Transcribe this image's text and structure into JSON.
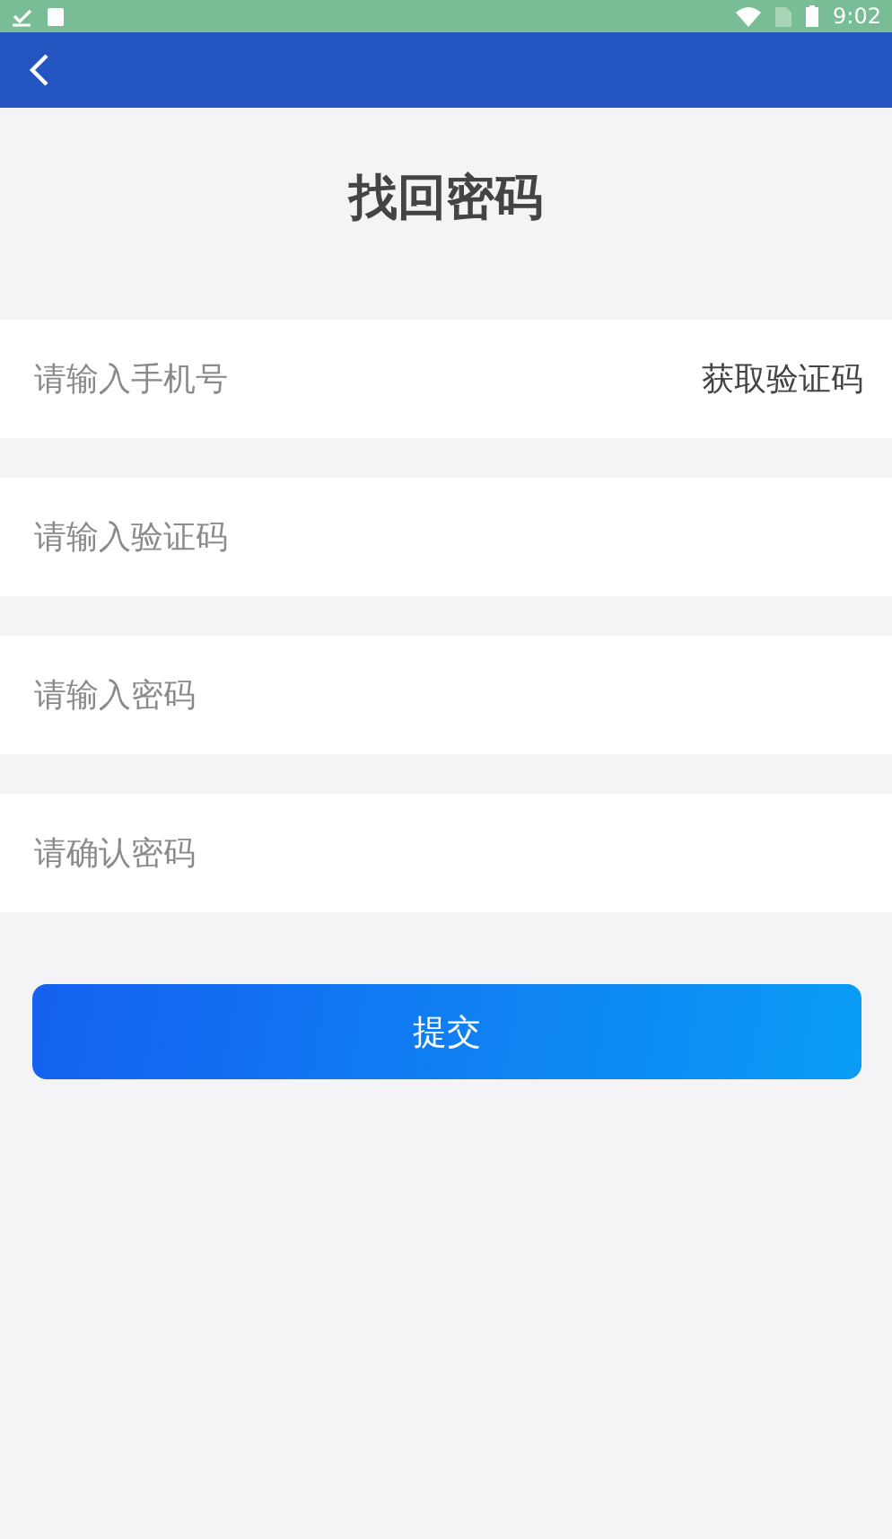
{
  "status_bar": {
    "time": "9:02"
  },
  "title": "找回密码",
  "fields": [
    {
      "placeholder": "请输入手机号",
      "action": "获取验证码"
    },
    {
      "placeholder": "请输入验证码"
    },
    {
      "placeholder": "请输入密码"
    },
    {
      "placeholder": "请确认密码"
    }
  ],
  "submit": "提交"
}
